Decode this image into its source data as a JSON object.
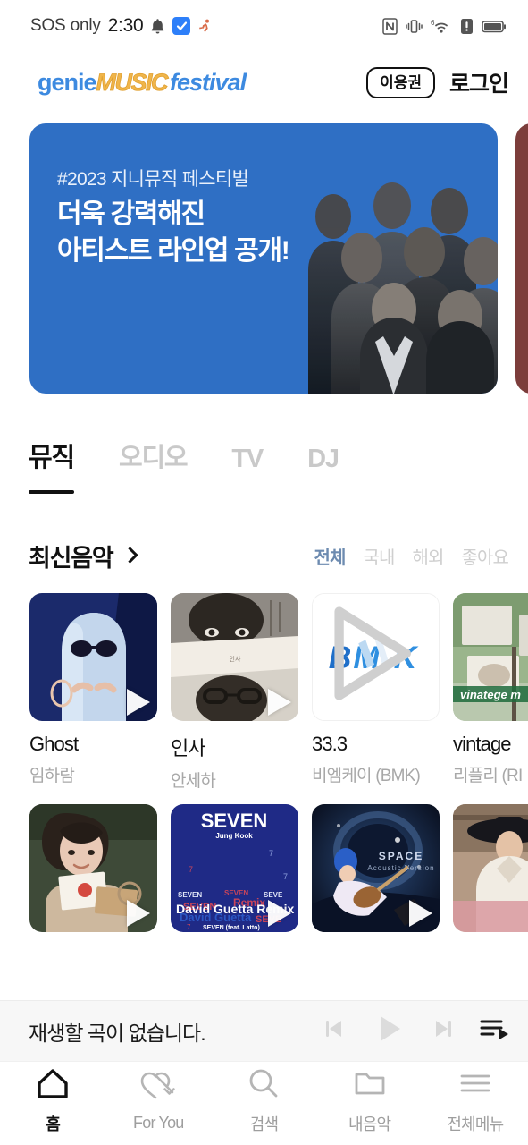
{
  "statusbar": {
    "carrier": "SOS only",
    "time": "2:30",
    "icons_left": [
      "bell-icon",
      "app-badge-icon",
      "running-icon"
    ],
    "icons_right": [
      "nfc-icon",
      "vibrate-icon",
      "wifi-6-icon",
      "alert-icon",
      "battery-icon"
    ]
  },
  "header": {
    "logo": {
      "part1": "genie",
      "part2": "MUSIC",
      "part3": "festival"
    },
    "ticket_label": "이용권",
    "login_label": "로그인"
  },
  "banner": {
    "tag": "#2023 지니뮤직 페스티벌",
    "title": "더욱 강력해진\n아티스트 라인업 공개!",
    "color": "#2f6fc4",
    "next_color": "#7c3d3b"
  },
  "tabs": [
    {
      "label": "뮤직",
      "active": true
    },
    {
      "label": "오디오",
      "active": false
    },
    {
      "label": "TV",
      "active": false
    },
    {
      "label": "DJ",
      "active": false
    }
  ],
  "section": {
    "title": "최신음악",
    "more_icon": "chevron-right-icon",
    "filters": [
      {
        "label": "전체",
        "active": true
      },
      {
        "label": "국내",
        "active": false
      },
      {
        "label": "해외",
        "active": false
      },
      {
        "label": "좋아요",
        "active": false
      }
    ]
  },
  "albums_row1": [
    {
      "title": "Ghost",
      "artist": "임하람",
      "art": "ghost"
    },
    {
      "title": "인사",
      "artist": "안세하",
      "art": "insa"
    },
    {
      "title": "33.3",
      "artist": "비엠케이 (BMK)",
      "art": "bmk"
    },
    {
      "title": "vintage",
      "artist": "리플리 (RI",
      "art": "vintage"
    }
  ],
  "albums_row2": [
    {
      "title": "",
      "artist": "",
      "art": "letters"
    },
    {
      "title": "",
      "artist": "",
      "art": "seven"
    },
    {
      "title": "",
      "artist": "",
      "art": "space"
    },
    {
      "title": "",
      "artist": "",
      "art": "hanbok"
    }
  ],
  "player": {
    "text": "재생할 곡이 없습니다.",
    "prev_icon": "skip-previous-icon",
    "play_icon": "play-icon",
    "next_icon": "skip-next-icon",
    "playlist_icon": "playlist-icon"
  },
  "bottomnav": [
    {
      "label": "홈",
      "icon": "home-icon",
      "active": true
    },
    {
      "label": "For You",
      "icon": "heart-arrow-icon",
      "active": false
    },
    {
      "label": "검색",
      "icon": "search-icon",
      "active": false
    },
    {
      "label": "내음악",
      "icon": "folder-icon",
      "active": false
    },
    {
      "label": "전체메뉴",
      "icon": "hamburger-icon",
      "active": false
    }
  ]
}
